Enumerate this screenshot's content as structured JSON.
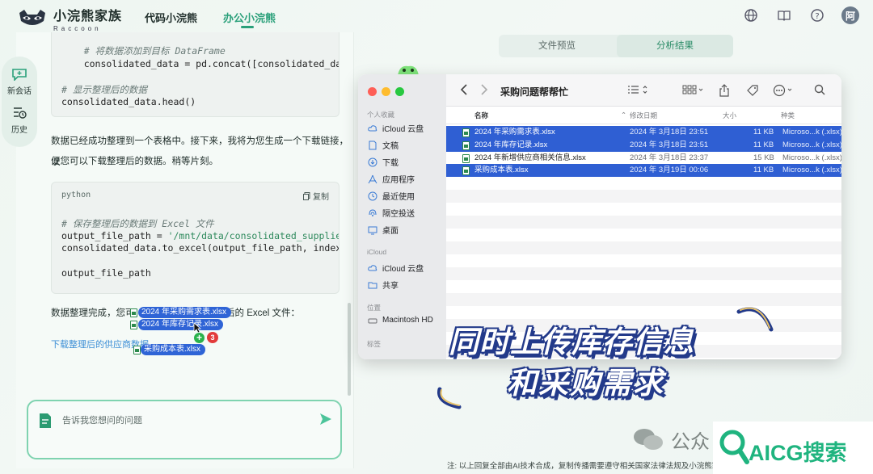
{
  "app": {
    "name": "小浣熊家族",
    "sub": "Raccoon",
    "nav": [
      "代码小浣熊",
      "办公小浣熊"
    ],
    "avatar": "阿"
  },
  "rail": {
    "new_chat": "新会话",
    "history": "历史"
  },
  "chat": {
    "code1": {
      "line1": "    # 将数据添加到目标 DataFrame",
      "line2": "    consolidated_data = pd.concat([consolidated_data,",
      "line3": "# 显示整理后的数据",
      "line4": "consolidated_data.head()"
    },
    "para1_a": "数据已经成功整理到一个表格中。接下来，我将为您生成一个下载链接，以",
    "para1_b": "便您可以下载整理后的数据。稍等片刻。",
    "code2": {
      "lang": "python",
      "copy": "复制",
      "line1": "# 保存整理后的数据到 Excel 文件",
      "line2_a": "output_file_path = ",
      "line2_b": "'/mnt/data/consolidated_supplier_da",
      "line3": "consolidated_data.to_excel(output_file_path, index=Fal",
      "line5": "output_file_path"
    },
    "para2_a": "数据整理完成，您可",
    "para2_b": "后的 Excel 文件：",
    "link": "下载整理后的供应商数据",
    "input_placeholder": "告诉我您想问的问题"
  },
  "drag": {
    "files": [
      "2024 年采购需求表.xlsx",
      "2024 年库存记录.xlsx",
      "采购成本表.xlsx"
    ],
    "count": "3",
    "plus": "+"
  },
  "right_tabs": [
    "文件预览",
    "分析结果"
  ],
  "finder": {
    "title": "采购问题帮帮忙",
    "sidebar": {
      "favorites": "个人收藏",
      "items": [
        "iCloud 云盘",
        "文稿",
        "下载",
        "应用程序",
        "最近使用",
        "隔空投送",
        "桌面"
      ],
      "icloud": "iCloud",
      "icloud_items": [
        "iCloud 云盘",
        "共享"
      ],
      "locations": "位置",
      "location_items": [
        "Macintosh HD"
      ],
      "tags": "标签"
    },
    "columns": {
      "name": "名称",
      "date": "修改日期",
      "size": "大小",
      "kind": "种类"
    },
    "rows": [
      {
        "name": "2024 年采购需求表.xlsx",
        "date": "2024 年 3月18日 23:51",
        "size": "11 KB",
        "kind": "Microso...k (.xlsx)",
        "selected": true
      },
      {
        "name": "2024 年库存记录.xlsx",
        "date": "2024 年 3月18日 23:51",
        "size": "11 KB",
        "kind": "Microso...k (.xlsx)",
        "selected": true
      },
      {
        "name": "2024 年新增供应商相关信息.xlsx",
        "date": "2024 年 3月18日 23:37",
        "size": "15 KB",
        "kind": "Microso...k (.xlsx)",
        "selected": false
      },
      {
        "name": "采购成本表.xlsx",
        "date": "2024 年 3月19日 00:06",
        "size": "11 KB",
        "kind": "Microso...k (.xlsx)",
        "selected": true
      }
    ]
  },
  "caption": {
    "line1": "同时上传库存信息",
    "line2": "和采购需求"
  },
  "disclaimer": "注: 以上回复全部由AI技术合成，复制传播需要遵守相关国家法律法规及小浣熊家族",
  "watermark": {
    "text": "公众",
    "brand": "AICG搜索"
  }
}
